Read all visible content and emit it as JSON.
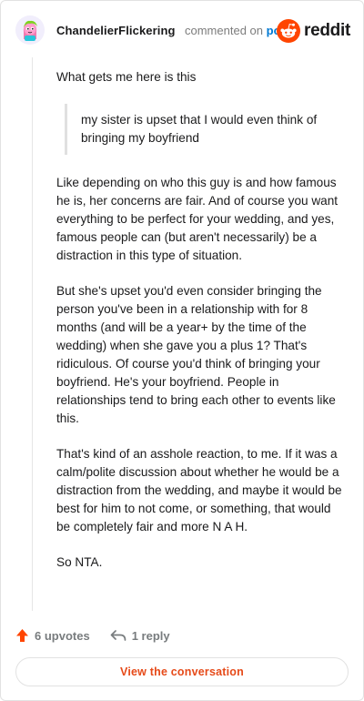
{
  "header": {
    "author": "ChandelierFlickering",
    "action_text": "commented on",
    "post_link": "post",
    "brand": "reddit"
  },
  "comment": {
    "intro": "What gets me here is this",
    "quote": "my sister is upset that I would even think of bringing my boyfriend",
    "paragraphs": [
      "Like depending on who this guy is and how famous he is, her concerns are fair. And of course you want everything to be perfect for your wedding, and yes, famous people can (but aren't necessarily) be a distraction in this type of situation.",
      "But she's upset you'd even consider bringing the person you've been in a relationship with for 8 months (and will be a year+ by the time of the wedding) when she gave you a plus 1? That's ridiculous. Of course you'd think of bringing your boyfriend. He's your boyfriend. People in relationships tend to bring each other to events like this.",
      "That's kind of an asshole reaction, to me. If it was a calm/polite discussion about whether he would be a distraction from the wedding, and maybe it would be best for him to not come, or something, that would be completely fair and more N A H.",
      "So NTA."
    ]
  },
  "footer": {
    "upvotes": "6 upvotes",
    "replies": "1 reply",
    "cta": "View the conversation"
  },
  "colors": {
    "upvote": "#ff4500",
    "link": "#0079d3",
    "cta": "#e64a19",
    "muted": "#787c7e"
  },
  "icons": [
    "avatar",
    "reddit-logo-icon",
    "upvote-arrow-icon",
    "reply-arrow-icon"
  ]
}
